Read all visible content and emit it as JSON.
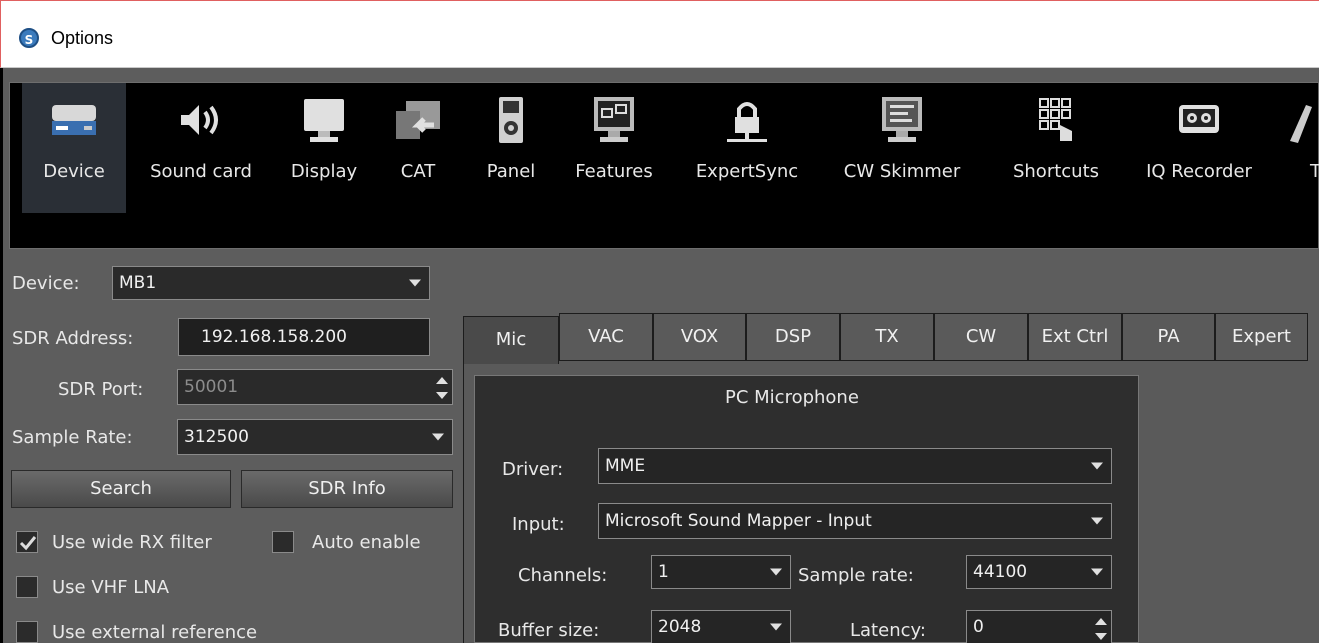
{
  "window": {
    "title": "Options",
    "app_icon": "S"
  },
  "toolbar": {
    "items": [
      {
        "label": "Device",
        "icon": "device-icon",
        "active": true
      },
      {
        "label": "Sound card",
        "icon": "speaker-icon"
      },
      {
        "label": "Display",
        "icon": "monitor-icon"
      },
      {
        "label": "CAT",
        "icon": "cat-icon"
      },
      {
        "label": "Panel",
        "icon": "panel-icon"
      },
      {
        "label": "Features",
        "icon": "features-icon"
      },
      {
        "label": "ExpertSync",
        "icon": "lock-icon"
      },
      {
        "label": "CW Skimmer",
        "icon": "cw-skimmer-icon"
      },
      {
        "label": "Shortcuts",
        "icon": "keypad-icon"
      },
      {
        "label": "IQ Recorder",
        "icon": "tape-icon"
      },
      {
        "label": "T",
        "icon": "partial-icon"
      }
    ]
  },
  "device_panel": {
    "device_label": "Device:",
    "device_value": "MB1",
    "sdr_address_label": "SDR Address:",
    "sdr_address_value": "192.168.158.200",
    "sdr_port_label": "SDR Port:",
    "sdr_port_value": "50001",
    "sample_rate_label": "Sample Rate:",
    "sample_rate_value": "312500",
    "search_button": "Search",
    "sdr_info_button": "SDR Info",
    "wide_rx_label": "Use wide RX filter",
    "wide_rx_checked": true,
    "auto_enable_label": "Auto enable",
    "auto_enable_checked": false,
    "vhf_lna_label": "Use VHF LNA",
    "vhf_lna_checked": false,
    "ext_ref_label": "Use external reference",
    "ext_ref_checked": false
  },
  "tabs": [
    {
      "label": "Mic",
      "active": true
    },
    {
      "label": "VAC"
    },
    {
      "label": "VOX"
    },
    {
      "label": "DSP"
    },
    {
      "label": "TX"
    },
    {
      "label": "CW"
    },
    {
      "label": "Ext Ctrl"
    },
    {
      "label": "PA"
    },
    {
      "label": "Expert"
    }
  ],
  "mic": {
    "group_title": "PC Microphone",
    "driver_label": "Driver:",
    "driver_value": "MME",
    "input_label": "Input:",
    "input_value": "Microsoft Sound Mapper - Input",
    "channels_label": "Channels:",
    "channels_value": "1",
    "sample_rate_label": "Sample rate:",
    "sample_rate_value": "44100",
    "buffer_label": "Buffer size:",
    "buffer_value": "2048",
    "latency_label": "Latency:",
    "latency_value": "0"
  }
}
